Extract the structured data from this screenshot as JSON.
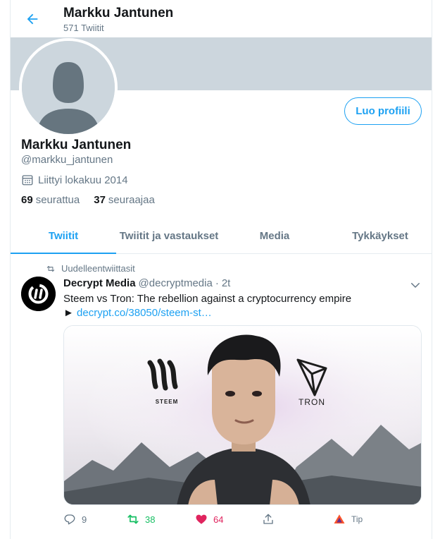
{
  "header": {
    "name": "Markku Jantunen",
    "tweet_count": "571 Twiitit"
  },
  "profile": {
    "edit_label": "Luo profiili",
    "name": "Markku Jantunen",
    "handle": "@markku_jantunen",
    "joined": "Liittyi lokakuu 2014",
    "following_count": "69",
    "following_label": "seurattua",
    "followers_count": "37",
    "followers_label": "seuraajaa"
  },
  "tabs": [
    {
      "label": "Twiitit",
      "active": true
    },
    {
      "label": "Twiitit ja vastaukset",
      "active": false
    },
    {
      "label": "Media",
      "active": false
    },
    {
      "label": "Tykkäykset",
      "active": false
    }
  ],
  "tweet": {
    "retweet_label": "Uudelleentwiittasit",
    "author": "Decrypt Media",
    "handle": "@decryptmedia",
    "separator": "·",
    "time": "2t",
    "text": "Steem vs Tron: The rebellion against a cryptocurrency empire",
    "link_prefix": "►",
    "link": "decrypt.co/38050/steem-st…",
    "media": {
      "steem_label": "STEEM",
      "tron_label": "TRON"
    },
    "actions": {
      "reply_count": "9",
      "retweet_count": "38",
      "like_count": "64",
      "tip_label": "Tip"
    }
  },
  "colors": {
    "accent": "#1da1f2",
    "retweet_green": "#17bf63",
    "like_red": "#e0245e",
    "muted": "#657786",
    "banner": "#ccd6dd"
  },
  "icons": [
    "back-arrow-icon",
    "calendar-icon",
    "retweet-icon",
    "chevron-down-icon",
    "reply-icon",
    "heart-icon",
    "share-icon",
    "tip-icon"
  ]
}
